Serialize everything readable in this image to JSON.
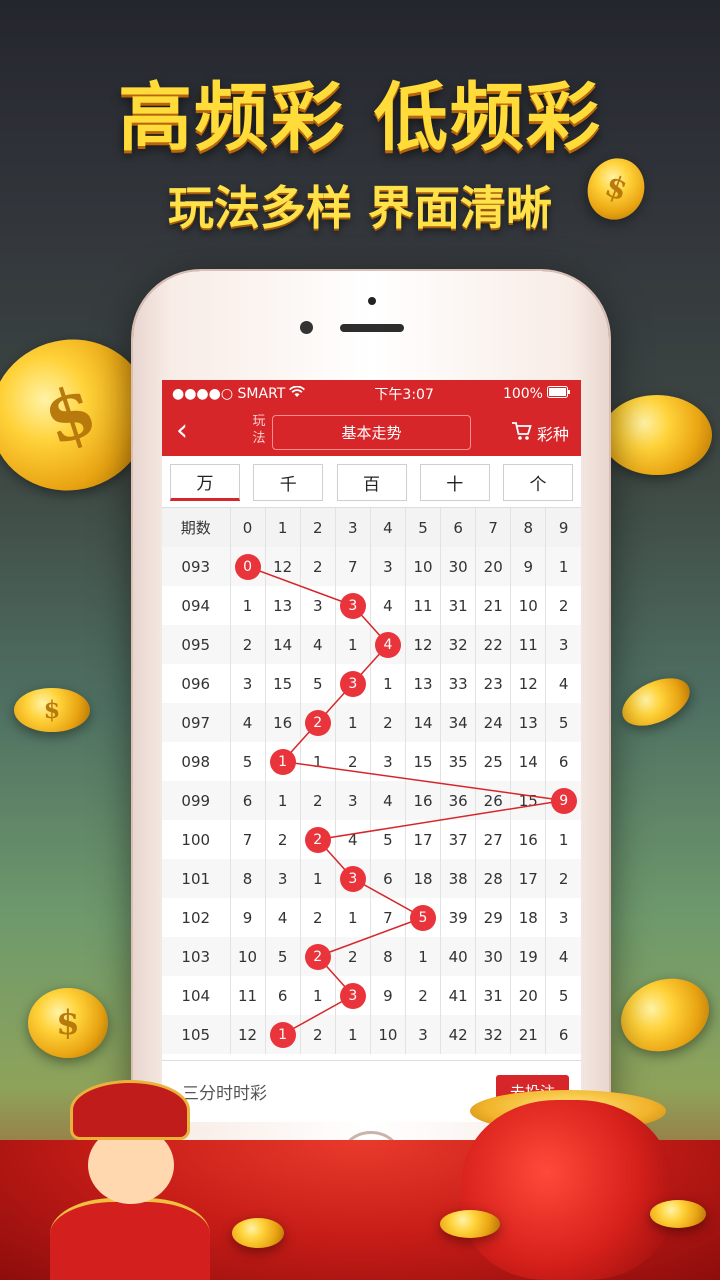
{
  "promo": {
    "headline": "高频彩 低频彩",
    "subline": "玩法多样 界面清晰"
  },
  "status_bar": {
    "carrier": "●●●●○ SMART",
    "time": "下午3:07",
    "battery": "100%"
  },
  "nav": {
    "back_icon": "‹",
    "play_label": "玩法",
    "play_select": "基本走势",
    "kind_label": "彩种"
  },
  "tabs": [
    "万",
    "千",
    "百",
    "十",
    "个"
  ],
  "active_tab": 0,
  "chart_data": {
    "type": "table",
    "columns": [
      "期数",
      "0",
      "1",
      "2",
      "3",
      "4",
      "5",
      "6",
      "7",
      "8",
      "9"
    ],
    "rows": [
      {
        "period": "093",
        "cells": [
          "0",
          "12",
          "2",
          "7",
          "3",
          "10",
          "30",
          "20",
          "9",
          "1"
        ],
        "hit": 0
      },
      {
        "period": "094",
        "cells": [
          "1",
          "13",
          "3",
          "3",
          "4",
          "11",
          "31",
          "21",
          "10",
          "2"
        ],
        "hit": 3
      },
      {
        "period": "095",
        "cells": [
          "2",
          "14",
          "4",
          "1",
          "4",
          "12",
          "32",
          "22",
          "11",
          "3"
        ],
        "hit": 4
      },
      {
        "period": "096",
        "cells": [
          "3",
          "15",
          "5",
          "3",
          "1",
          "13",
          "33",
          "23",
          "12",
          "4"
        ],
        "hit": 3
      },
      {
        "period": "097",
        "cells": [
          "4",
          "16",
          "2",
          "1",
          "2",
          "14",
          "34",
          "24",
          "13",
          "5"
        ],
        "hit": 2
      },
      {
        "period": "098",
        "cells": [
          "5",
          "1",
          "1",
          "2",
          "3",
          "15",
          "35",
          "25",
          "14",
          "6"
        ],
        "hit": 1
      },
      {
        "period": "099",
        "cells": [
          "6",
          "1",
          "2",
          "3",
          "4",
          "16",
          "36",
          "26",
          "15",
          "9"
        ],
        "hit": 9
      },
      {
        "period": "100",
        "cells": [
          "7",
          "2",
          "2",
          "4",
          "5",
          "17",
          "37",
          "27",
          "16",
          "1"
        ],
        "hit": 2
      },
      {
        "period": "101",
        "cells": [
          "8",
          "3",
          "1",
          "3",
          "6",
          "18",
          "38",
          "28",
          "17",
          "2"
        ],
        "hit": 3
      },
      {
        "period": "102",
        "cells": [
          "9",
          "4",
          "2",
          "1",
          "7",
          "5",
          "39",
          "29",
          "18",
          "3"
        ],
        "hit": 5
      },
      {
        "period": "103",
        "cells": [
          "10",
          "5",
          "2",
          "2",
          "8",
          "1",
          "40",
          "30",
          "19",
          "4"
        ],
        "hit": 2
      },
      {
        "period": "104",
        "cells": [
          "11",
          "6",
          "1",
          "3",
          "9",
          "2",
          "41",
          "31",
          "20",
          "5"
        ],
        "hit": 3
      },
      {
        "period": "105",
        "cells": [
          "12",
          "1",
          "2",
          "1",
          "10",
          "3",
          "42",
          "32",
          "21",
          "6"
        ],
        "hit": 1
      }
    ]
  },
  "bottom": {
    "game_name": "三分时时彩",
    "bet_label": "去投注"
  },
  "colors": {
    "accent": "#d6262a",
    "hit_ball": "#e8343a",
    "headline": "#ffdc3a"
  }
}
